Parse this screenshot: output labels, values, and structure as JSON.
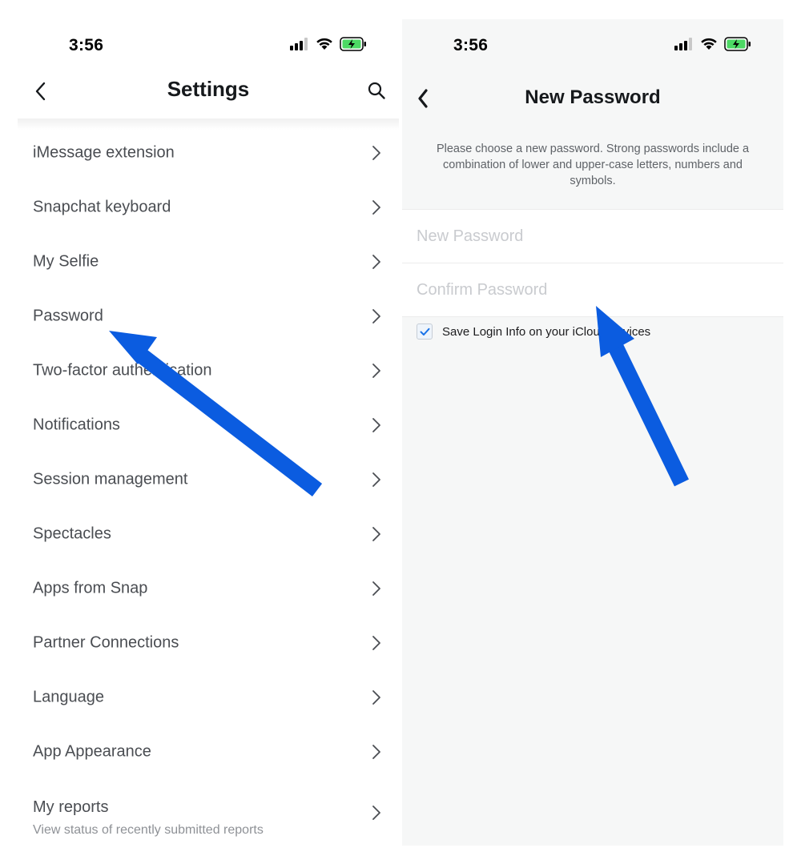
{
  "left": {
    "status": {
      "time": "3:56"
    },
    "header": {
      "title": "Settings"
    },
    "menu": [
      {
        "label": "iMessage extension"
      },
      {
        "label": "Snapchat keyboard"
      },
      {
        "label": "My Selfie"
      },
      {
        "label": "Password"
      },
      {
        "label": "Two-factor authentication"
      },
      {
        "label": "Notifications"
      },
      {
        "label": "Session management"
      },
      {
        "label": "Spectacles"
      },
      {
        "label": "Apps from Snap"
      },
      {
        "label": "Partner Connections"
      },
      {
        "label": "Language"
      },
      {
        "label": "App Appearance"
      },
      {
        "label": "My reports",
        "sublabel": "View status of recently submitted reports"
      }
    ]
  },
  "right": {
    "status": {
      "time": "3:56"
    },
    "header": {
      "title": "New Password"
    },
    "description": "Please choose a new password. Strong passwords include a combination of lower and upper-case letters, numbers and symbols.",
    "fields": {
      "new_password_placeholder": "New Password",
      "confirm_password_placeholder": "Confirm Password"
    },
    "save_login": {
      "label": "Save Login Info on your iCloud devices",
      "checked": true
    }
  },
  "colors": {
    "arrow": "#0b5ce0",
    "battery": "#4cd964",
    "check": "#1a73e8"
  },
  "icons": [
    "back-chevron-icon",
    "search-icon",
    "chevron-right-icon",
    "signal-icon",
    "wifi-icon",
    "battery-charging-icon",
    "checkbox-check-icon",
    "arrow-annotation-icon"
  ]
}
